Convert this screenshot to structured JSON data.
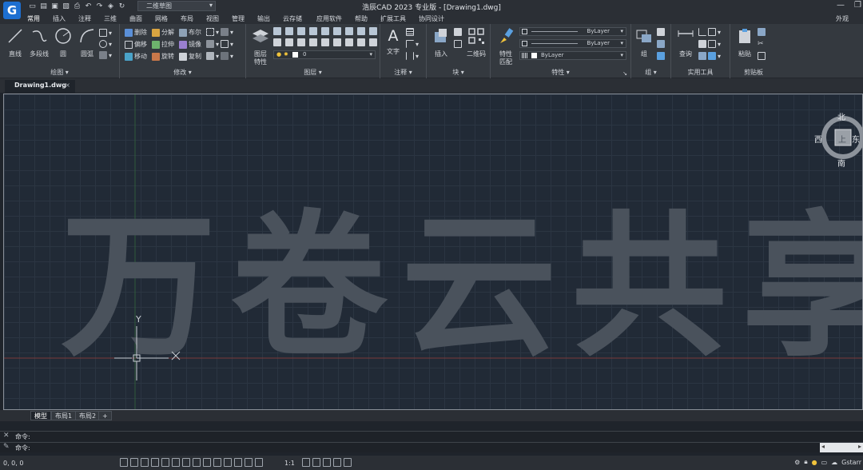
{
  "app": {
    "logo_letter": "G",
    "title": "浩辰CAD 2023 专业版 - [Drawing1.dwg]",
    "workspace": "二维草图",
    "appearance": "外观"
  },
  "menu": [
    "常用",
    "插入",
    "注释",
    "三维",
    "曲面",
    "网格",
    "布局",
    "视图",
    "管理",
    "输出",
    "云存储",
    "应用软件",
    "帮助",
    "扩展工具",
    "协同设计"
  ],
  "ribbon": {
    "draw": {
      "title": "绘图",
      "line": "直线",
      "polyline": "多段线",
      "circle": "圆",
      "arc": "圆弧"
    },
    "modify": {
      "title": "修改",
      "erase": "删除",
      "explode": "分解",
      "boolean": "布尔",
      "offset": "偏移",
      "stretch": "拉伸",
      "mirror": "镜像",
      "move": "移动",
      "rotate": "旋转",
      "copy": "复制"
    },
    "layer": {
      "title": "图层",
      "props": "图层\n特性",
      "current": "0"
    },
    "annotate": {
      "title": "注释",
      "text": "文字"
    },
    "block": {
      "title": "块",
      "insert": "插入",
      "qrcode": "二维码"
    },
    "properties": {
      "title": "特性",
      "match": "特性\n匹配",
      "color": "ByLayer",
      "linetype": "ByLayer",
      "lineweight": "ByLayer"
    },
    "group": {
      "title": "组",
      "label": "组"
    },
    "utilities": {
      "title": "实用工具",
      "query": "查询"
    },
    "clipboard": {
      "title": "剪贴板",
      "paste": "粘贴"
    }
  },
  "doc_tab": "Drawing1.dwg",
  "canvas": {
    "big_text": "万卷云共享",
    "ucs_y": "Y",
    "ucs_x": "X",
    "compass": {
      "north": "北",
      "south": "南",
      "west": "西",
      "east": "东",
      "center": "上"
    }
  },
  "layout_tabs": [
    "模型",
    "布局1",
    "布局2",
    "+"
  ],
  "command": {
    "line1": "命令:",
    "line2": "命令:"
  },
  "status": {
    "coords": "0, 0, 0",
    "scale": "1:1",
    "app_name": "Gstarr"
  }
}
